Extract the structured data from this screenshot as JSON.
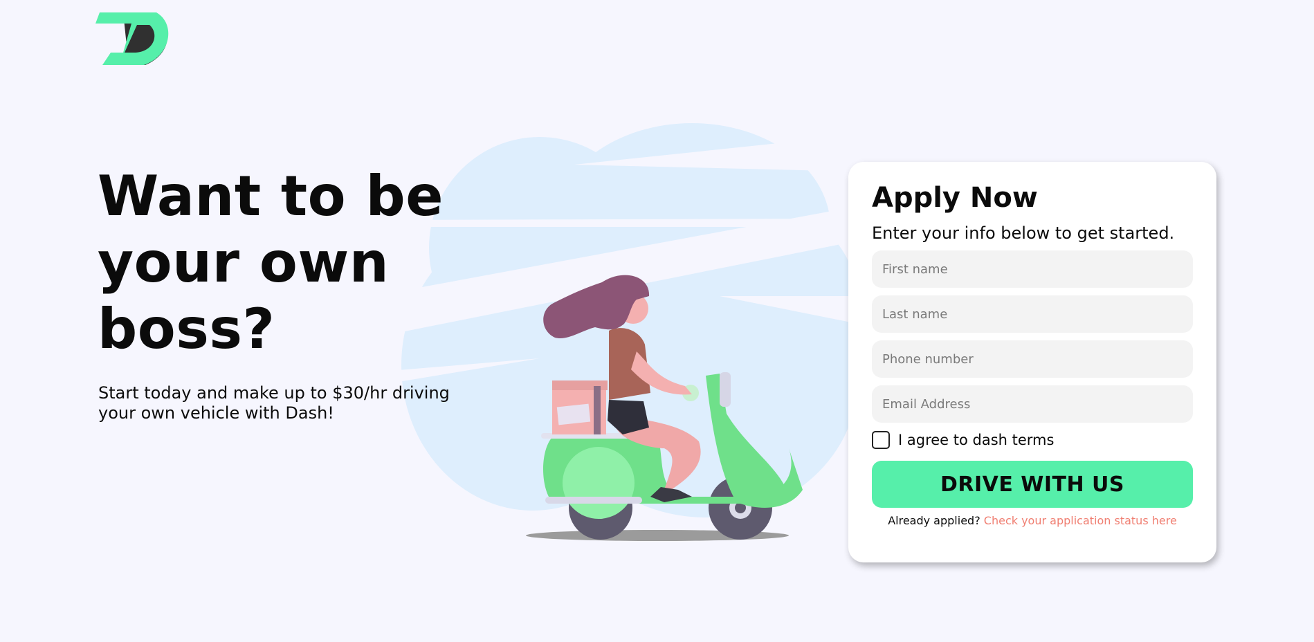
{
  "brand": {
    "accent": "#56efaa",
    "link_color": "#f07f72"
  },
  "logo": {
    "icon": "dash-logo-icon"
  },
  "hero": {
    "headline": "Want to be your own boss?",
    "subtext": "Start today and make up to $30/hr driving your own vehicle with Dash!"
  },
  "illustration": {
    "icon": "scooter-delivery-illustration"
  },
  "form": {
    "title": "Apply Now",
    "subtitle": "Enter your info below to get started.",
    "fields": {
      "first_name": {
        "placeholder": "First name",
        "value": ""
      },
      "last_name": {
        "placeholder": "Last name",
        "value": ""
      },
      "phone": {
        "placeholder": "Phone number",
        "value": ""
      },
      "email": {
        "placeholder": "Email Address",
        "value": ""
      }
    },
    "terms_label": "I agree to dash terms",
    "terms_checked": false,
    "submit_label": "DRIVE WITH US",
    "status_prefix": "Already applied?",
    "status_link": "Check your application status here"
  }
}
